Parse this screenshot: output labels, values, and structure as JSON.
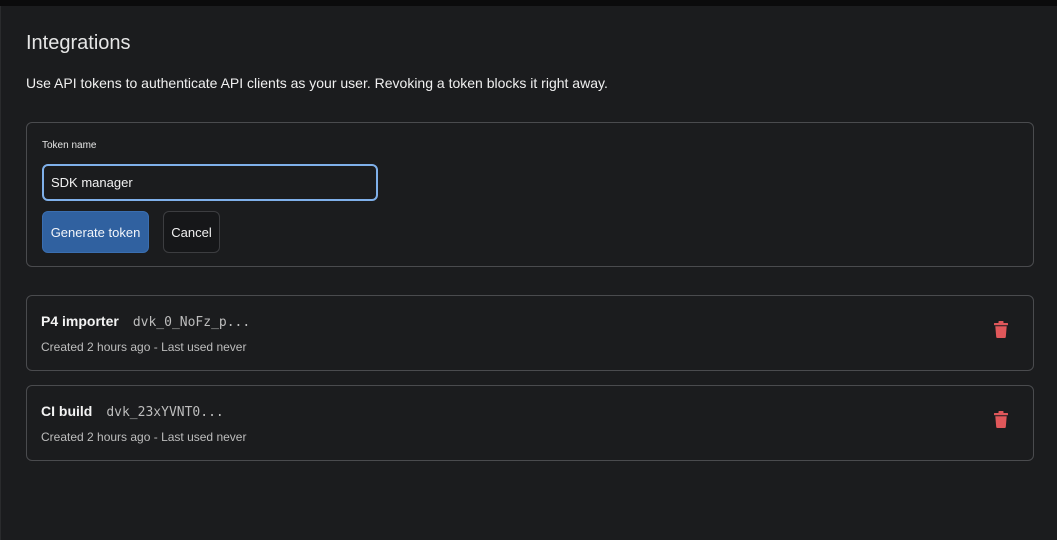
{
  "header": {
    "title": "Integrations",
    "description": "Use API tokens to authenticate API clients as your user. Revoking a token blocks it right away."
  },
  "form": {
    "label": "Token name",
    "value": "SDK manager",
    "generate_label": "Generate token",
    "cancel_label": "Cancel"
  },
  "tokens": [
    {
      "name": "P4 importer",
      "prefix": "dvk_0_NoFz_p...",
      "meta": "Created 2 hours ago - Last used never",
      "delete_icon": "trash-icon"
    },
    {
      "name": "CI build",
      "prefix": "dvk_23xYVNT0...",
      "meta": "Created 2 hours ago - Last used never",
      "delete_icon": "trash-icon"
    }
  ],
  "colors": {
    "background": "#1b1c1e",
    "accent": "#3061a0",
    "focus": "#7fb0ea",
    "danger": "#e0575a"
  }
}
